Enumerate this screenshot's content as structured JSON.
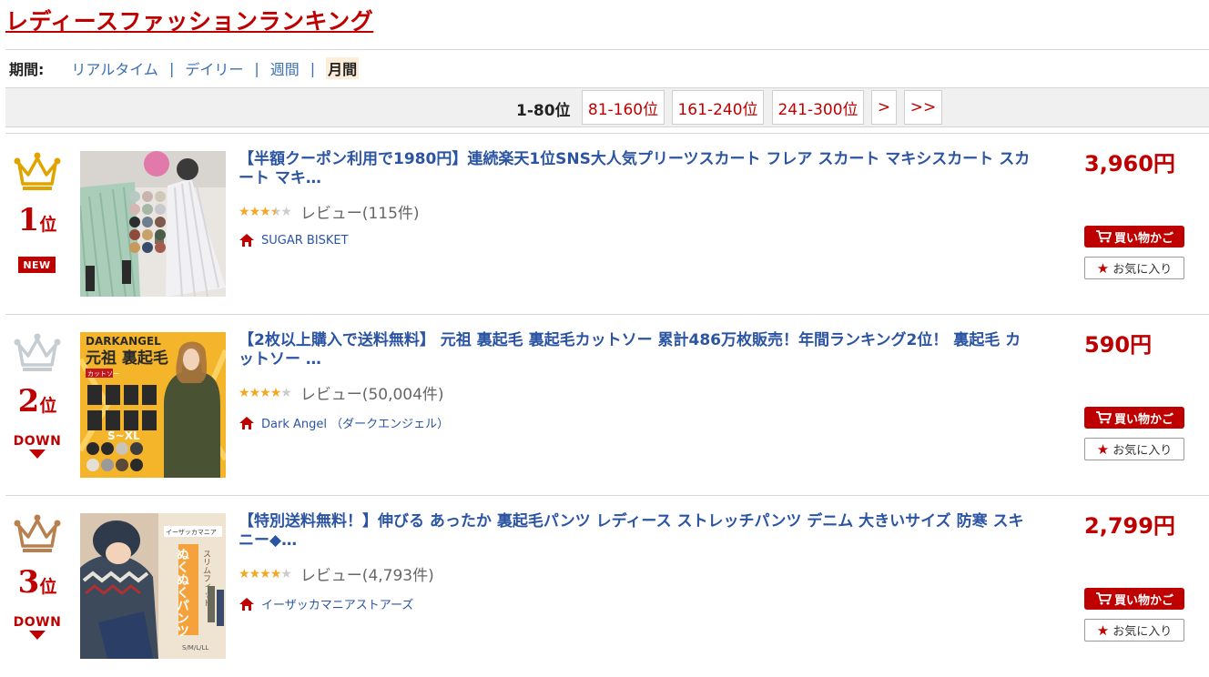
{
  "page": {
    "title": "レディースファッションランキング"
  },
  "period": {
    "label": "期間:",
    "options": [
      "リアルタイム",
      "デイリー",
      "週間"
    ],
    "current": "月間",
    "separator": "|"
  },
  "pager": {
    "current": "1-80位",
    "links": [
      "81-160位",
      "161-240位",
      "241-300位",
      ">",
      ">>"
    ]
  },
  "colors": {
    "accent": "#bf0000",
    "link": "#2b54a3",
    "gold": "#e0a400",
    "silver": "#c5ccd2",
    "bronze": "#b8804e"
  },
  "icons": {
    "shop": "house-icon",
    "cart": "cart-icon",
    "favorite": "star-icon"
  },
  "items": [
    {
      "rank_num": "1",
      "rank_unit": "位",
      "badge": "NEW",
      "crown": "gold",
      "title": "【半額クーポン利用で1980円】連続楽天1位SNS大人気プリーツスカート フレア スカート マキシスカート スカート マキ…",
      "rating": 3.5,
      "stars": "★★★★★",
      "review": "レビュー(115件)",
      "shop": "SUGAR BISKET",
      "price": "3,960円",
      "cart": "買い物かご",
      "fav": "お気に入り"
    },
    {
      "rank_num": "2",
      "rank_unit": "位",
      "badge": "DOWN",
      "crown": "silver",
      "title": "【2枚以上購入で送料無料】 元祖 裏起毛 裏起毛カットソー 累計486万枚販売！年間ランキング2位！ 裏起毛 カットソー …",
      "rating": 4,
      "stars": "★★★★★",
      "review": "レビュー(50,004件)",
      "shop": "Dark Angel （ダークエンジェル）",
      "price": "590円",
      "cart": "買い物かご",
      "fav": "お気に入り",
      "thumb": {
        "brand": "DARKANGEL",
        "headline": "元祖 裏起毛",
        "sub": "カットソー",
        "size": "S~XL"
      }
    },
    {
      "rank_num": "3",
      "rank_unit": "位",
      "badge": "DOWN",
      "crown": "bronze",
      "title": "【特別送料無料！】伸びる あったか 裏起毛パンツ レディース ストレッチパンツ デニム 大きいサイズ 防寒 スキニー◆…",
      "rating": 4,
      "stars": "★★★★★",
      "review": "レビュー(4,793件)",
      "shop": "イーザッカマニアストアーズ",
      "price": "2,799円",
      "cart": "買い物かご",
      "fav": "お気に入り",
      "thumb": {
        "store": "イーザッカマニア",
        "headline": "ぬくぬくパンツ",
        "sub": "スリムフィット",
        "size": "S/M/L/LL"
      }
    }
  ]
}
